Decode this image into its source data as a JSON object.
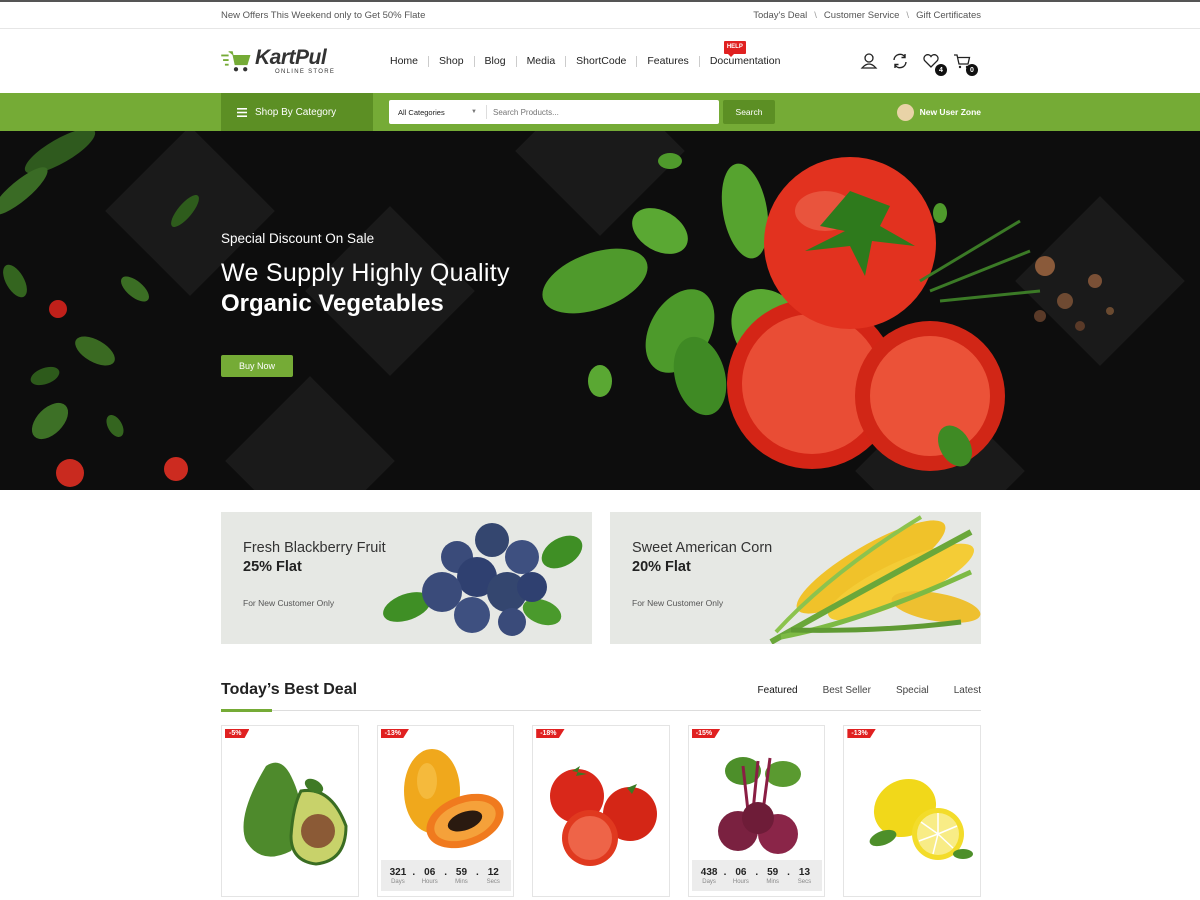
{
  "topbar": {
    "offer": "New Offers This Weekend only to Get 50% Flate",
    "links": [
      "Today's Deal",
      "Customer Service",
      "Gift Certificates"
    ],
    "separator": "\\"
  },
  "header": {
    "logo_name": "KartPul",
    "logo_sub": "ONLINE STORE",
    "nav": [
      "Home",
      "Shop",
      "Blog",
      "Media",
      "ShortCode",
      "Features",
      "Documentation"
    ],
    "help_badge": "HELP",
    "wishlist_count": "4",
    "cart_count": "0",
    "icons": [
      "user-icon",
      "refresh-icon",
      "heart-icon",
      "cart-icon"
    ]
  },
  "greenbar": {
    "category_label": "Shop By Category",
    "select_value": "All Categories",
    "search_placeholder": "Search Products...",
    "search_button": "Search",
    "user_zone": "New User Zone"
  },
  "hero": {
    "kicker": "Special Discount On Sale",
    "line1": "We Supply Highly Quality",
    "line2": "Organic Vegetables",
    "button": "Buy Now"
  },
  "promos": [
    {
      "title": "Fresh Blackberry Fruit",
      "offer": "25% Flat",
      "note": "For New Customer Only"
    },
    {
      "title": "Sweet American Corn",
      "offer": "20% Flat",
      "note": "For New Customer Only"
    }
  ],
  "deal": {
    "title": "Today’s Best Deal",
    "tabs": [
      "Featured",
      "Best Seller",
      "Special",
      "Latest"
    ]
  },
  "timer_labels": [
    "Days",
    "Hours",
    "Mins",
    "Secs"
  ],
  "products": [
    {
      "discount": "-5%"
    },
    {
      "discount": "-13%",
      "timer": [
        "321",
        "06",
        "59",
        "12"
      ]
    },
    {
      "discount": "-18%"
    },
    {
      "discount": "-15%",
      "timer": [
        "438",
        "06",
        "59",
        "13"
      ]
    },
    {
      "discount": "-13%"
    }
  ],
  "colors": {
    "accent": "#75ab36",
    "accent_dark": "#5c8f24",
    "sale": "#e02020",
    "hero_bg": "#0d0d0d"
  }
}
